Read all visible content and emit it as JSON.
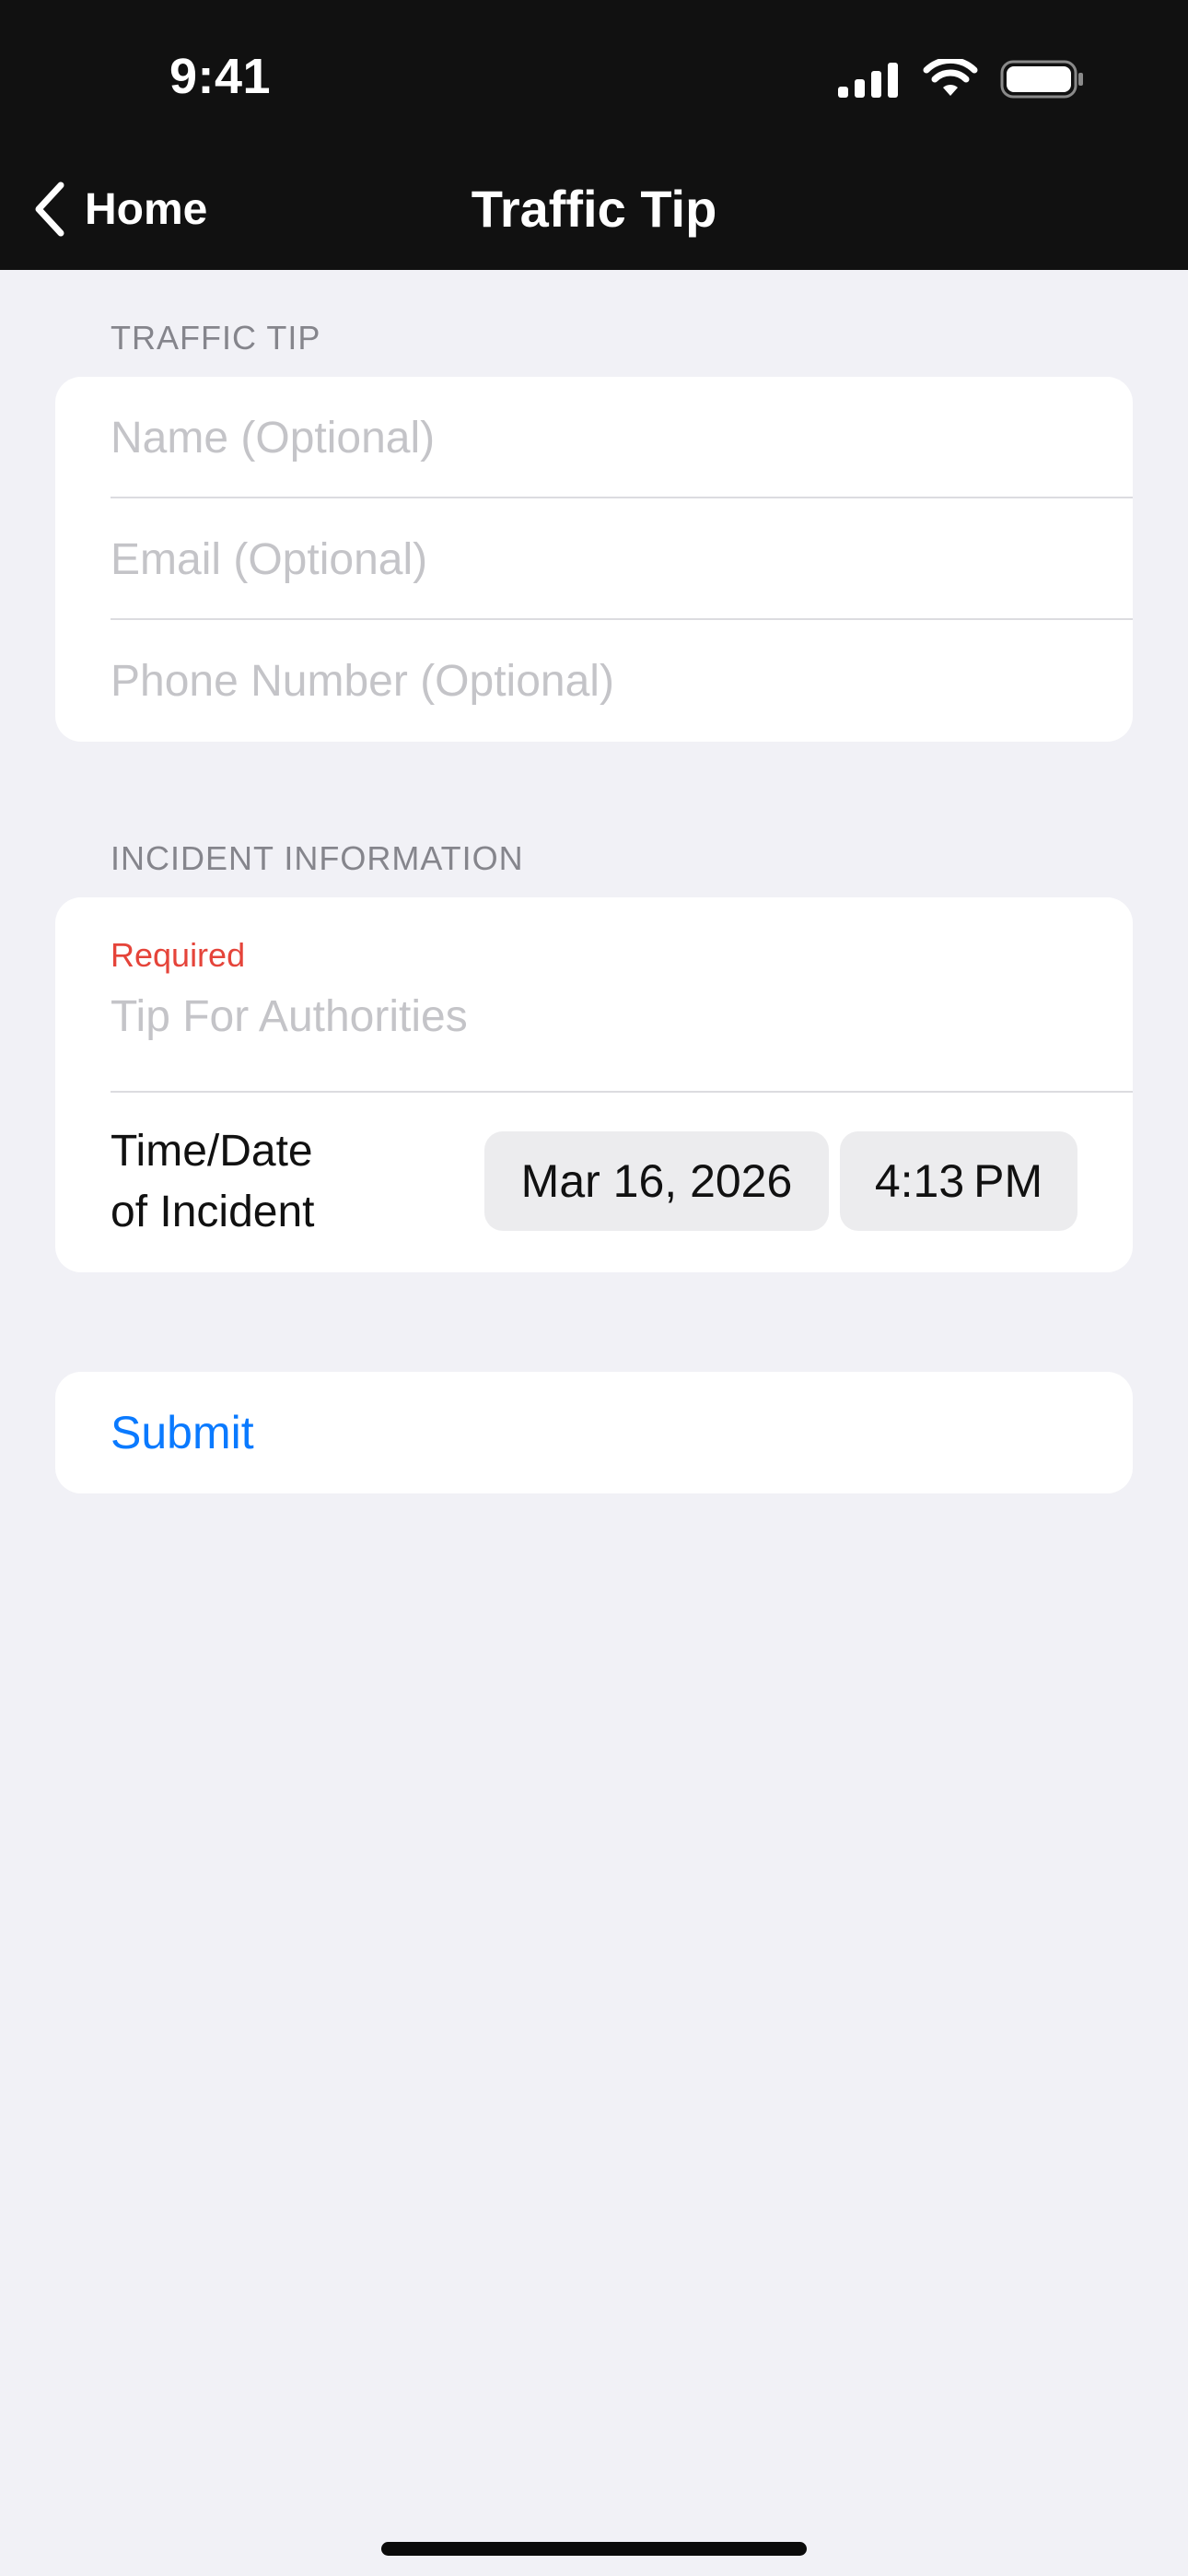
{
  "status_bar": {
    "time": "9:41",
    "icons": [
      "cellular-signal-icon",
      "wifi-icon",
      "battery-icon"
    ]
  },
  "nav": {
    "back_label": "Home",
    "back_icon": "chevron-left-icon",
    "title": "Traffic Tip"
  },
  "traffic_tip_section": {
    "header": "TRAFFIC TIP",
    "name_placeholder": "Name (Optional)",
    "email_placeholder": "Email (Optional)",
    "phone_placeholder": "Phone Number (Optional)",
    "name_value": "",
    "email_value": "",
    "phone_value": ""
  },
  "incident_section": {
    "header": "INCIDENT INFORMATION",
    "required_label": "Required",
    "tip_placeholder": "Tip For Authorities",
    "tip_value": "",
    "datetime_label_line1": "Time/Date",
    "datetime_label_line2": "of Incident",
    "date_value": "Mar 16, 2026",
    "time_value": "4:13 PM"
  },
  "actions": {
    "submit_label": "Submit"
  },
  "colors": {
    "header_bg": "#111111",
    "page_bg": "#f1f1f6",
    "required": "#e5443a",
    "accent": "#0a7aff",
    "placeholder": "#c4c4c8",
    "section_label": "#85858c"
  }
}
